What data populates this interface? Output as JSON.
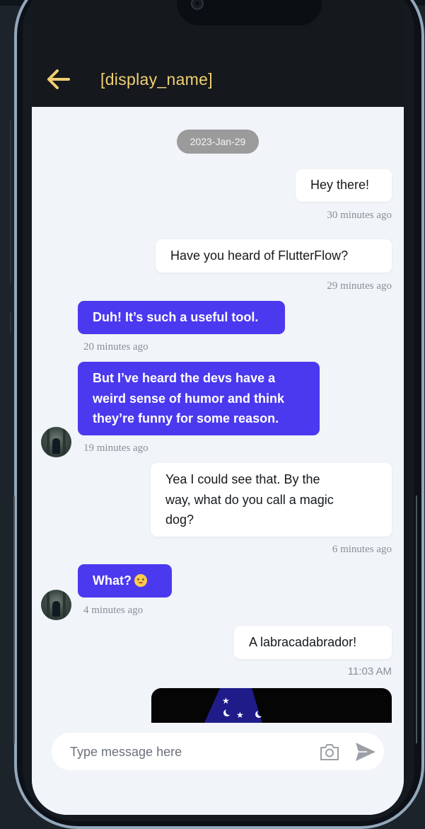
{
  "header": {
    "title": "[display_name]",
    "back_icon": "arrow-back-icon",
    "accent_color": "#f1d073"
  },
  "date_chip": "2023-Jan-29",
  "messages": [
    {
      "side": "sent",
      "text": "Hey there!",
      "time": "30 minutes ago"
    },
    {
      "side": "sent",
      "text": "Have you heard of FlutterFlow?",
      "time": "29 minutes ago"
    },
    {
      "side": "received",
      "text": "Duh! It’s such a useful tool.",
      "time": "20 minutes ago"
    },
    {
      "side": "received",
      "lines": [
        "But I’ve heard the devs have a",
        "weird sense of humor and think",
        "they’re funny for some reason."
      ],
      "time": "19 minutes ago"
    },
    {
      "side": "sent",
      "lines": [
        "Yea I could see that. By the",
        "way, what do you call a magic",
        "dog?"
      ],
      "time": "6 minutes ago"
    },
    {
      "side": "received",
      "text": "What?",
      "emoji": "face-with-raised-eyebrow-emoji",
      "time": "4 minutes ago"
    },
    {
      "side": "sent",
      "text": "A labracadabrador!",
      "time": "11:03 AM"
    },
    {
      "side": "sent",
      "type": "image",
      "image": "wizard-hat-image"
    }
  ],
  "composer": {
    "placeholder": "Type message here",
    "camera_icon": "camera-icon",
    "send_icon": "send-icon"
  },
  "colors": {
    "sent_bubble": "#ffffff",
    "received_bubble": "#4b39ef",
    "app_bar": "#15191d",
    "background": "#f1f4f8"
  }
}
